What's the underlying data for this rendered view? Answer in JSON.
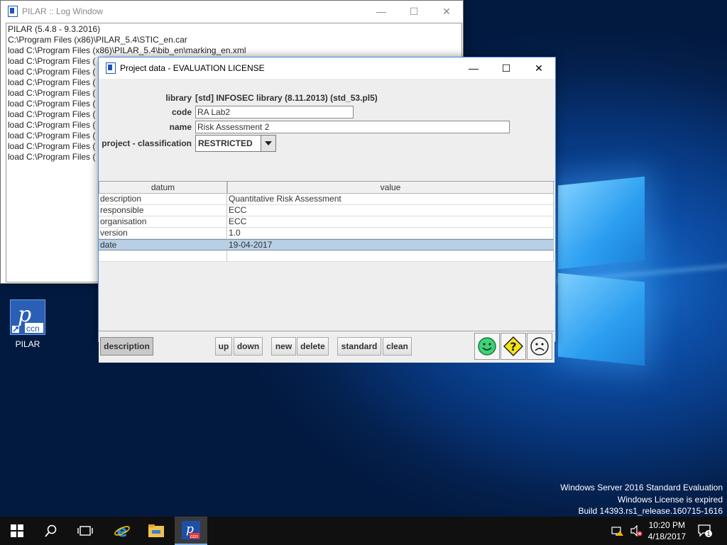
{
  "desktop": {
    "watermark": {
      "line1": "Windows Server 2016 Standard Evaluation",
      "line2": "Windows License is expired",
      "line3": "Build 14393.rs1_release.160715-1616"
    },
    "icons": [
      {
        "label": "PILAR",
        "icon": "pilar-ccn-icon"
      }
    ]
  },
  "log_window": {
    "title": "PILAR :: Log Window",
    "lines": [
      "PILAR (5.4.8 - 9.3.2016)",
      "C:\\Program Files (x86)\\PILAR_5.4\\STIC_en.car",
      "load C:\\Program Files (x86)\\PILAR_5.4\\bib_en\\marking_en.xml",
      "load C:\\Program Files (",
      "load C:\\Program Files (",
      "load C:\\Program Files (",
      "load C:\\Program Files (",
      "load C:\\Program Files (",
      "load C:\\Program Files (",
      "load C:\\Program Files (",
      "load C:\\Program Files (",
      "load C:\\Program Files (",
      "load C:\\Program Files ("
    ]
  },
  "project_window": {
    "title": "Project data - EVALUATION LICENSE",
    "library_label": "library",
    "library_value": "[std] INFOSEC library (8.11.2013) (std_53.pl5)",
    "code_label": "code",
    "code_value": "RA Lab2",
    "name_label": "name",
    "name_value": "Risk Assessment 2",
    "classification_label": "project - classification",
    "classification_value": "RESTRICTED",
    "table": {
      "headers": [
        "datum",
        "value"
      ],
      "rows": [
        {
          "datum": "description",
          "value": "Quantitative Risk Assessment"
        },
        {
          "datum": "responsible",
          "value": "ECC"
        },
        {
          "datum": "organisation",
          "value": "ECC"
        },
        {
          "datum": "version",
          "value": "1.0"
        },
        {
          "datum": "date",
          "value": "19-04-2017"
        },
        {
          "datum": "",
          "value": ""
        }
      ],
      "selected_row": 4
    },
    "buttons": {
      "description": "description",
      "up": "up",
      "down": "down",
      "new": "new",
      "delete": "delete",
      "standard": "standard",
      "clean": "clean"
    }
  },
  "taskbar": {
    "items": [
      "start-icon",
      "search-icon",
      "task-view-icon",
      "internet-explorer-icon",
      "file-explorer-icon",
      "pilar-app-icon"
    ],
    "clock_time": "10:20 PM",
    "clock_date": "4/18/2017",
    "notification_count": "1"
  }
}
